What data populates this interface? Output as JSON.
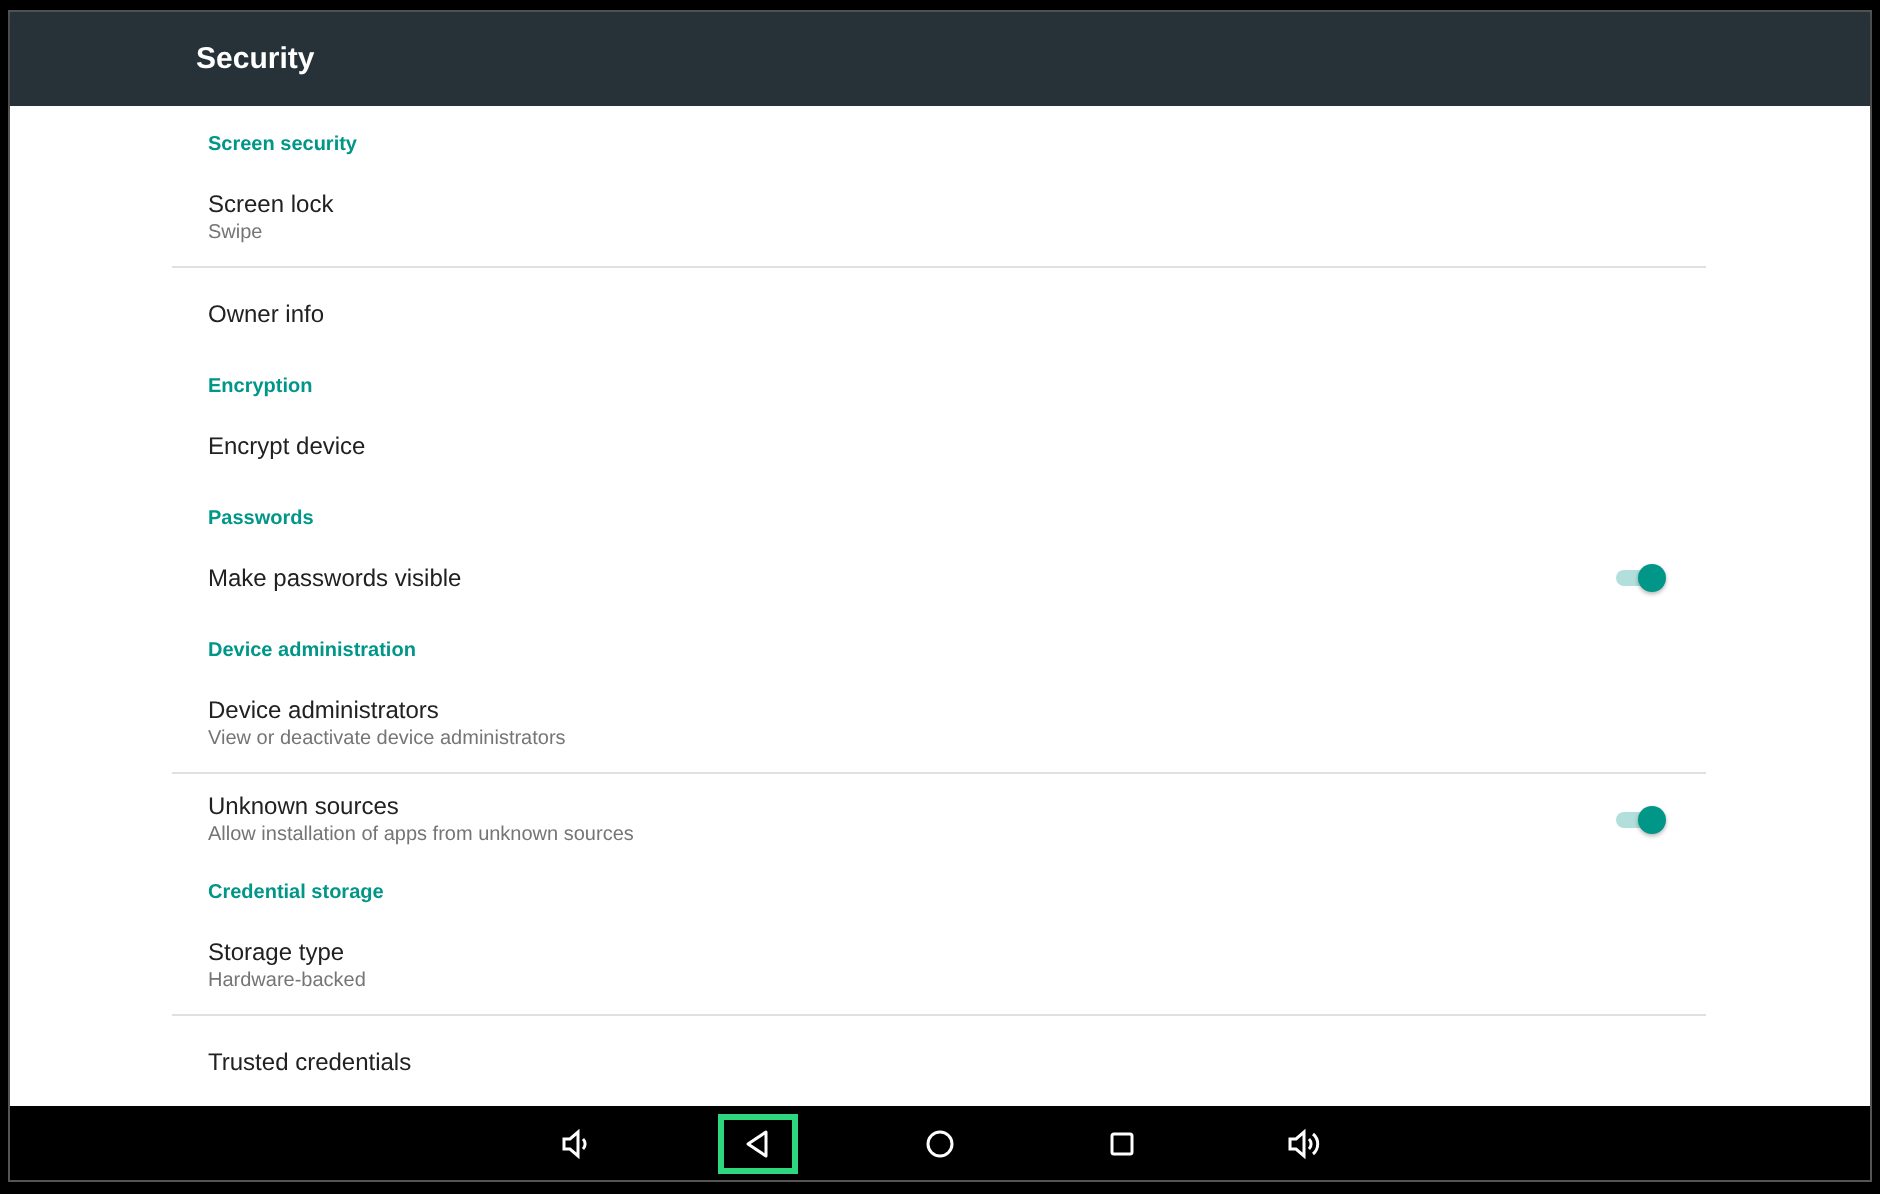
{
  "app_bar": {
    "title": "Security"
  },
  "items": [
    {
      "kind": "header",
      "title": "Screen security"
    },
    {
      "kind": "pref",
      "title": "Screen lock",
      "summary": "Swipe",
      "divider": true
    },
    {
      "kind": "pref",
      "title": "Owner info",
      "divider": false
    },
    {
      "kind": "header",
      "title": "Encryption"
    },
    {
      "kind": "pref",
      "title": "Encrypt device",
      "divider": false
    },
    {
      "kind": "header",
      "title": "Passwords"
    },
    {
      "kind": "switch",
      "title": "Make passwords visible",
      "on": true,
      "divider": false
    },
    {
      "kind": "header",
      "title": "Device administration"
    },
    {
      "kind": "pref",
      "title": "Device administrators",
      "summary": "View or deactivate device administrators",
      "divider": true
    },
    {
      "kind": "switch",
      "title": "Unknown sources",
      "summary": "Allow installation of apps from unknown sources",
      "on": true,
      "divider": false
    },
    {
      "kind": "header",
      "title": "Credential storage"
    },
    {
      "kind": "pref",
      "title": "Storage type",
      "summary": "Hardware-backed",
      "divider": true
    },
    {
      "kind": "pref",
      "title": "Trusted credentials",
      "divider": false
    }
  ],
  "nav_bar": [
    {
      "kind": "volume_down",
      "highlighted": false
    },
    {
      "kind": "back",
      "highlighted": true
    },
    {
      "kind": "home",
      "highlighted": false
    },
    {
      "kind": "recents",
      "highlighted": false
    },
    {
      "kind": "volume_up",
      "highlighted": false
    }
  ]
}
